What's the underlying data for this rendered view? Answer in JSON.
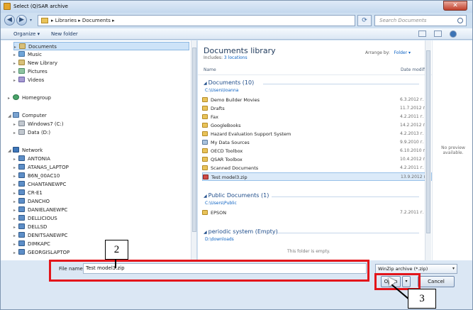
{
  "window": {
    "title": "Select (Q)SAR archive"
  },
  "address": {
    "breadcrumb": "▸ Libraries ▸ Documents ▸",
    "search_placeholder": "Search Documents"
  },
  "toolbar": {
    "organize": "Organize ▾",
    "new_folder": "New folder"
  },
  "nav": {
    "libraries": [
      "Documents",
      "Music",
      "New Library",
      "Pictures",
      "Videos"
    ],
    "homegroup": "Homegroup",
    "computer": "Computer",
    "drives": [
      "Windows7 (C:)",
      "Data (D:)"
    ],
    "network": "Network",
    "hosts": [
      "ANTONIA",
      "ATANAS_LAPTOP",
      "B6N_00AC10",
      "CHANTANEWPC",
      "CR-E1",
      "DANCHO",
      "DANIELANEWPC",
      "DELLICIOUS",
      "DELLSD",
      "DENITSANEWPC",
      "DIMKAPC",
      "GEORGISLAPTOP"
    ]
  },
  "library": {
    "title": "Documents library",
    "includes_label": "Includes:",
    "includes_link": "3 locations",
    "arrange_label": "Arrange by:",
    "arrange_value": "Folder ▾"
  },
  "columns": {
    "name": "Name",
    "date": "Date modifi"
  },
  "groups": [
    {
      "title": "Documents (10)",
      "path": "C:\\Users\\Ioanna",
      "items": [
        {
          "name": "Demo Builder Movies",
          "date": "6.3.2012 г. 1",
          "type": "folder"
        },
        {
          "name": "Drafts",
          "date": "11.7.2012 г.",
          "type": "folder"
        },
        {
          "name": "Fax",
          "date": "4.2.2011 г. 1",
          "type": "folder"
        },
        {
          "name": "GoogleBooks",
          "date": "14.2.2012 г.",
          "type": "folder"
        },
        {
          "name": "Hazard Evaluation Support System",
          "date": "4.2.2013 г. 1",
          "type": "folder"
        },
        {
          "name": "My Data Sources",
          "date": "9.9.2010 г. 1",
          "type": "data"
        },
        {
          "name": "OECD Toolbox",
          "date": "6.10.2010 г.",
          "type": "folder"
        },
        {
          "name": "QSAR Toolbox",
          "date": "10.4.2012 г.",
          "type": "folder"
        },
        {
          "name": "Scanned Documents",
          "date": "4.2.2011 г. 1",
          "type": "folder"
        },
        {
          "name": "Test model3.zip",
          "date": "13.9.2012 г.",
          "type": "zip"
        }
      ]
    },
    {
      "title": "Public Documents (1)",
      "path": "C:\\Users\\Public",
      "items": [
        {
          "name": "EPSON",
          "date": "7.2.2011 г. 1",
          "type": "folder"
        }
      ]
    },
    {
      "title": "periodic system (Empty)",
      "path": "D:\\downloads",
      "items": []
    }
  ],
  "empty_message": "This folder is empty.",
  "preview": {
    "text": "No preview available."
  },
  "footer": {
    "filename_label": "File name:",
    "filename_value": "Test model3.zip",
    "filetype": "WinZip archive (*.zip)",
    "open": "Open",
    "cancel": "Cancel"
  },
  "callouts": {
    "c2": "2",
    "c3": "3"
  },
  "colors": {
    "accent": "#1e395b",
    "highlight": "#e3161b",
    "selection": "#dbeaf9"
  }
}
